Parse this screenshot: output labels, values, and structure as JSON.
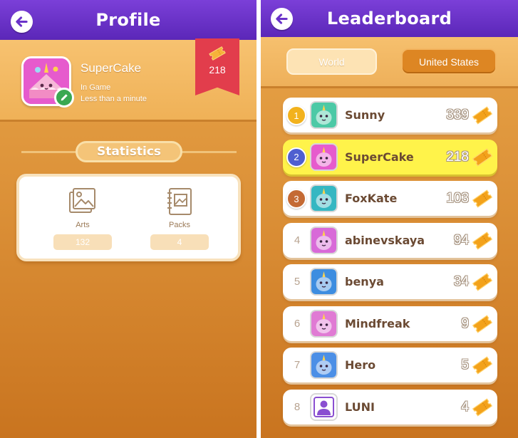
{
  "profile": {
    "title": "Profile",
    "username": "SuperCake",
    "status": "In Game",
    "last_seen": "Less than a minute",
    "tickets": "218",
    "statistics_title": "Statistics",
    "stats": [
      {
        "label": "Arts",
        "value": "132",
        "icon": "image-icon"
      },
      {
        "label": "Packs",
        "value": "4",
        "icon": "album-icon"
      }
    ]
  },
  "leaderboard": {
    "title": "Leaderboard",
    "tabs": [
      {
        "label": "World",
        "active": false
      },
      {
        "label": "United States",
        "active": true
      }
    ],
    "rows": [
      {
        "rank": "1",
        "name": "Sunny",
        "score": "339",
        "medal": "#f2b21d",
        "avatar": "#4cc9a6",
        "highlight": false
      },
      {
        "rank": "2",
        "name": "SuperCake",
        "score": "218",
        "medal": "#4f5fd0",
        "avatar": "#e65bcd",
        "highlight": true
      },
      {
        "rank": "3",
        "name": "FoxKate",
        "score": "103",
        "medal": "#c46a34",
        "avatar": "#35b7c2",
        "highlight": false
      },
      {
        "rank": "4",
        "name": "abinevskaya",
        "score": "94",
        "medal": "",
        "avatar": "#d86ad8",
        "highlight": false
      },
      {
        "rank": "5",
        "name": "benya",
        "score": "34",
        "medal": "",
        "avatar": "#3d8de0",
        "highlight": false
      },
      {
        "rank": "6",
        "name": "Mindfreak",
        "score": "9",
        "medal": "",
        "avatar": "#e07bd4",
        "highlight": false
      },
      {
        "rank": "7",
        "name": "Hero",
        "score": "5",
        "medal": "",
        "avatar": "#4c8fe6",
        "highlight": false
      },
      {
        "rank": "8",
        "name": "LUNI",
        "score": "4",
        "medal": "",
        "avatar": "#ffffff",
        "highlight": false
      }
    ]
  },
  "colors": {
    "topbar": "#6a33c9",
    "panel_bg": "#dc9138",
    "ribbon": "#e23d4c",
    "highlight_row": "#fff34a",
    "ticket": "#f3a21b"
  }
}
